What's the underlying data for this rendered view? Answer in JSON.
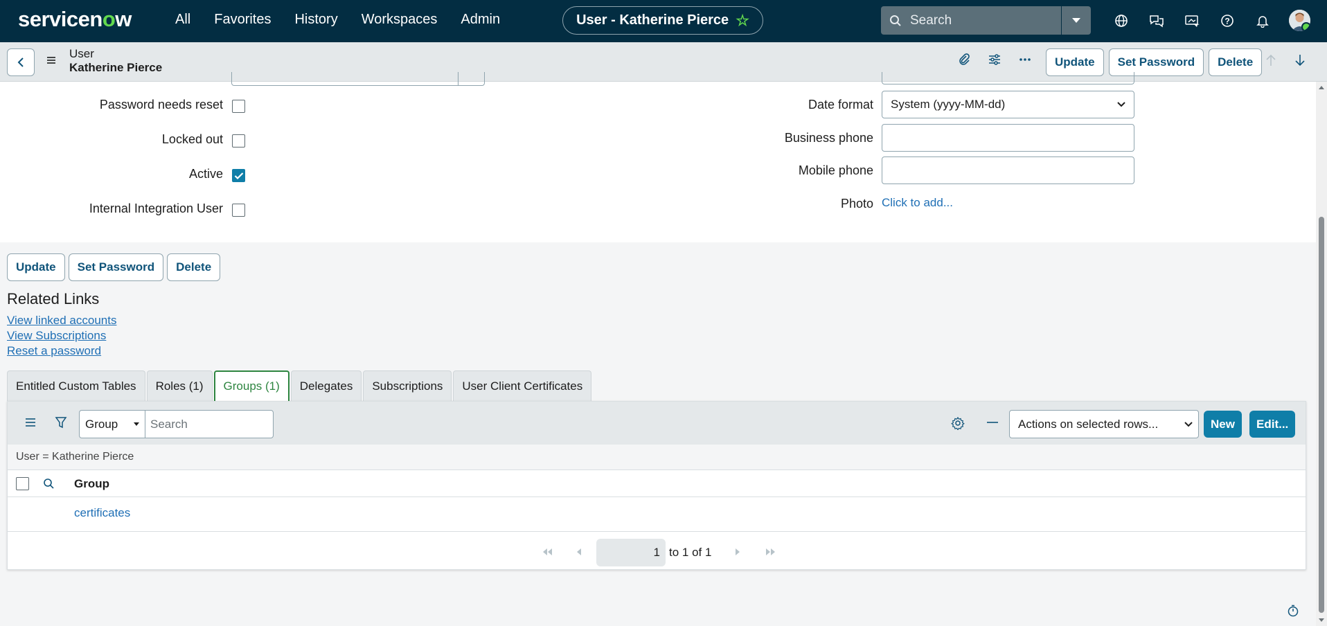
{
  "nav": {
    "logo_main": "servicen",
    "logo_o": "o",
    "logo_end": "w",
    "items": [
      "All",
      "Favorites",
      "History",
      "Workspaces",
      "Admin"
    ],
    "record_title": "User - Katherine Pierce",
    "search_placeholder": "Search"
  },
  "header": {
    "table_label": "User",
    "record_name": "Katherine Pierce",
    "update_label": "Update",
    "set_password_label": "Set Password",
    "delete_label": "Delete"
  },
  "form": {
    "left_fields": [
      {
        "label": "Password needs reset",
        "checked": false
      },
      {
        "label": "Locked out",
        "checked": false
      },
      {
        "label": "Active",
        "checked": true
      },
      {
        "label": "Internal Integration User",
        "checked": false
      }
    ],
    "date_format_label": "Date format",
    "date_format_value": "System (yyyy-MM-dd)",
    "business_phone_label": "Business phone",
    "business_phone_value": "",
    "mobile_phone_label": "Mobile phone",
    "mobile_phone_value": "",
    "photo_label": "Photo",
    "photo_link": "Click to add..."
  },
  "bottom_buttons": {
    "update_label": "Update",
    "set_password_label": "Set Password",
    "delete_label": "Delete"
  },
  "related_links": {
    "title": "Related Links",
    "links": [
      "View linked accounts",
      "View Subscriptions",
      "Reset a password"
    ]
  },
  "tabs": {
    "items": [
      "Entitled Custom Tables",
      "Roles (1)",
      "Groups (1)",
      "Delegates",
      "Subscriptions",
      "User Client Certificates"
    ],
    "active": "Groups (1)"
  },
  "related_list": {
    "search_field": "Group",
    "search_placeholder": "Search",
    "actions_label": "Actions on selected rows...",
    "new_label": "New",
    "edit_label": "Edit...",
    "filter_text": "User = Katherine Pierce",
    "column_header": "Group",
    "rows": [
      "certificates"
    ],
    "page_value": "1",
    "page_text": "to 1 of 1"
  },
  "colors": {
    "nav_bg": "#032d42",
    "accent_green": "#62d84e",
    "primary_blue": "#0f7ea8",
    "link_blue": "#1f6fb5",
    "active_tab": "#2e8540"
  }
}
